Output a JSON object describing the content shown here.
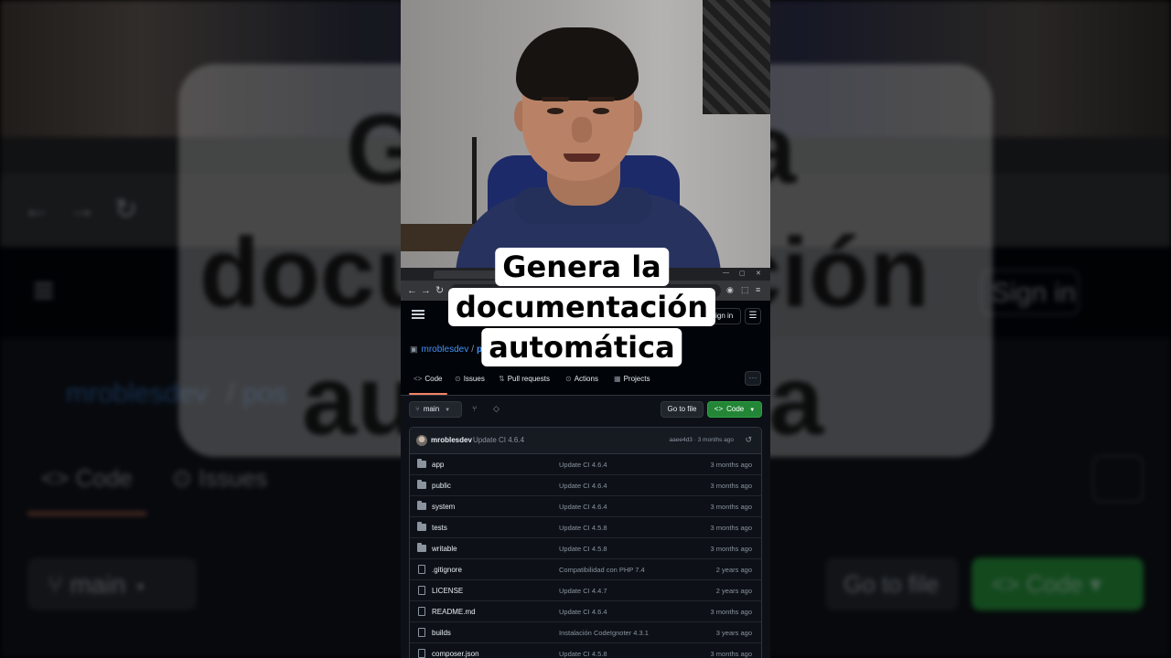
{
  "caption": {
    "line1": "Genera la",
    "line2": "documentación",
    "line3": "automática"
  },
  "colors": {
    "github_bg": "#0d1117",
    "github_header": "#010409",
    "border": "#30363d",
    "link": "#4493f8",
    "accent_underline": "#f78166",
    "code_button": "#238636",
    "muted_text": "#8b949e"
  },
  "browser": {
    "back_icon": "arrow-left-icon",
    "forward_icon": "arrow-right-icon",
    "reload_icon": "reload-icon"
  },
  "github": {
    "sign_in": "Sign in",
    "repo": {
      "owner": "mroblesdev",
      "name": "pos"
    },
    "tabs": [
      {
        "label": "Code",
        "icon": "code-icon"
      },
      {
        "label": "Issues",
        "icon": "issue-icon"
      },
      {
        "label": "Pull requests",
        "icon": "pull-request-icon"
      },
      {
        "label": "Actions",
        "icon": "actions-icon"
      },
      {
        "label": "Projects",
        "icon": "projects-icon"
      }
    ],
    "more": "···",
    "branch": "main",
    "go_to_file": "Go to file",
    "code_button": "Code",
    "latest_commit": {
      "author": "mroblesdev",
      "message": "Update CI 4.6.4",
      "meta": "aaee4d3 · 3 months ago"
    },
    "files": [
      {
        "name": "app",
        "type": "dir",
        "commit": "Update CI 4.6.4",
        "age": "3 months ago"
      },
      {
        "name": "public",
        "type": "dir",
        "commit": "Update CI 4.6.4",
        "age": "3 months ago"
      },
      {
        "name": "system",
        "type": "dir",
        "commit": "Update CI 4.6.4",
        "age": "3 months ago"
      },
      {
        "name": "tests",
        "type": "dir",
        "commit": "Update CI 4.5.8",
        "age": "3 months ago"
      },
      {
        "name": "writable",
        "type": "dir",
        "commit": "Update CI 4.5.8",
        "age": "3 months ago"
      },
      {
        "name": ".gitignore",
        "type": "file",
        "commit": "Compatibilidad con PHP 7.4",
        "age": "2 years ago"
      },
      {
        "name": "LICENSE",
        "type": "file",
        "commit": "Update CI 4.4.7",
        "age": "2 years ago"
      },
      {
        "name": "README.md",
        "type": "file",
        "commit": "Update CI 4.6.4",
        "age": "3 months ago"
      },
      {
        "name": "builds",
        "type": "file",
        "commit": "Instalación CodeIgnoter 4.3.1",
        "age": "3 years ago"
      },
      {
        "name": "composer.json",
        "type": "file",
        "commit": "Update CI 4.5.8",
        "age": "3 months ago"
      }
    ]
  }
}
